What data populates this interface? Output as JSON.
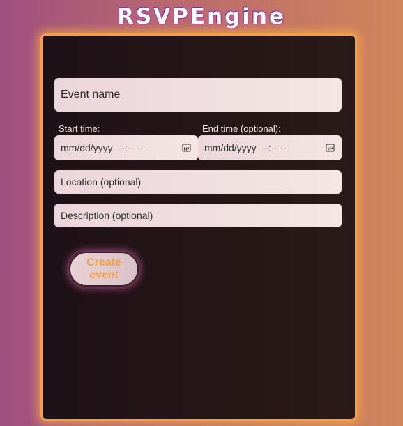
{
  "app": {
    "title": "RSVPEngine"
  },
  "form": {
    "event_name_placeholder": "Event name",
    "start_label": "Start time:",
    "end_label": "End time (optional):",
    "start_value": "mm/dd/yyyy  --:-- --",
    "end_value": "mm/dd/yyyy  --:-- --",
    "location_placeholder": "Location (optional)",
    "description_placeholder": "Description (optional)",
    "submit_label": "Create event",
    "calendar_icon": "calendar-icon"
  },
  "colors": {
    "accent": "#f0a04a",
    "card_bg": "#1e1117",
    "field_bg": "#f4e6e3"
  }
}
